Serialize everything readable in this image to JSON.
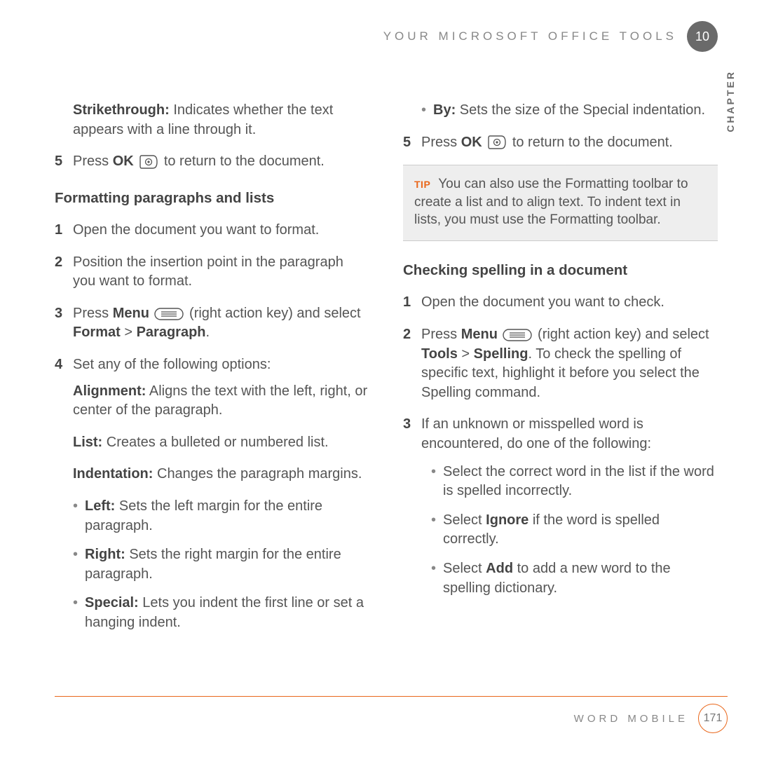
{
  "header": {
    "title": "YOUR MICROSOFT OFFICE TOOLS",
    "chapter_number": "10",
    "chapter_label": "CHAPTER"
  },
  "left": {
    "strikethrough_label": "Strikethrough:",
    "strikethrough_text": " Indicates whether the text appears with a line through it.",
    "step5_num": "5",
    "step5_a": "Press ",
    "step5_ok": "OK",
    "step5_b": " to return to the document.",
    "heading_format": "Formatting paragraphs and lists",
    "s1_num": "1",
    "s1_text": "Open the document you want to format.",
    "s2_num": "2",
    "s2_text": "Position the insertion point in the paragraph you want to format.",
    "s3_num": "3",
    "s3_a": "Press ",
    "s3_menu": "Menu",
    "s3_b": " (right action key) and select ",
    "s3_format": "Format",
    "s3_gt": " > ",
    "s3_paragraph": "Paragraph",
    "s3_end": ".",
    "s4_num": "4",
    "s4_text": "Set any of the following options:",
    "alignment_label": "Alignment:",
    "alignment_text": " Aligns the text with the left, right, or center of the paragraph.",
    "list_label": "List:",
    "list_text": " Creates a bulleted or numbered list.",
    "indent_label": "Indentation:",
    "indent_text": " Changes the paragraph margins.",
    "b_left_label": "Left:",
    "b_left_text": " Sets the left margin for the entire paragraph.",
    "b_right_label": "Right:",
    "b_right_text": " Sets the right margin for the entire paragraph.",
    "b_special_label": "Special:",
    "b_special_text": " Lets you indent the first line or set a hanging indent."
  },
  "right": {
    "b_by_label": "By:",
    "b_by_text": " Sets the size of the Special indentation.",
    "step5_num": "5",
    "step5_a": "Press ",
    "step5_ok": "OK",
    "step5_b": " to return to the document.",
    "tip_label": "TIP",
    "tip_text": " You can also use the Formatting toolbar to create a list and to align text. To indent text in lists, you must use the Formatting toolbar.",
    "heading_check": "Checking spelling in a document",
    "c1_num": "1",
    "c1_text": "Open the document you want to check.",
    "c2_num": "2",
    "c2_a": "Press ",
    "c2_menu": "Menu",
    "c2_b": " (right action key) and select ",
    "c2_tools": "Tools",
    "c2_gt": " > ",
    "c2_spelling": "Spelling",
    "c2_c": ". To check the spelling of specific text, highlight it before you select the Spelling command.",
    "c3_num": "3",
    "c3_text": "If an unknown or misspelled word is encountered, do one of the following:",
    "c3_b1": "Select the correct word in the list if the word is spelled incorrectly.",
    "c3_b2a": "Select ",
    "c3_b2_ignore": "Ignore",
    "c3_b2b": " if the word is spelled correctly.",
    "c3_b3a": "Select ",
    "c3_b3_add": "Add",
    "c3_b3b": " to add a new word to the spelling dictionary."
  },
  "footer": {
    "title": "WORD MOBILE",
    "page": "171"
  }
}
